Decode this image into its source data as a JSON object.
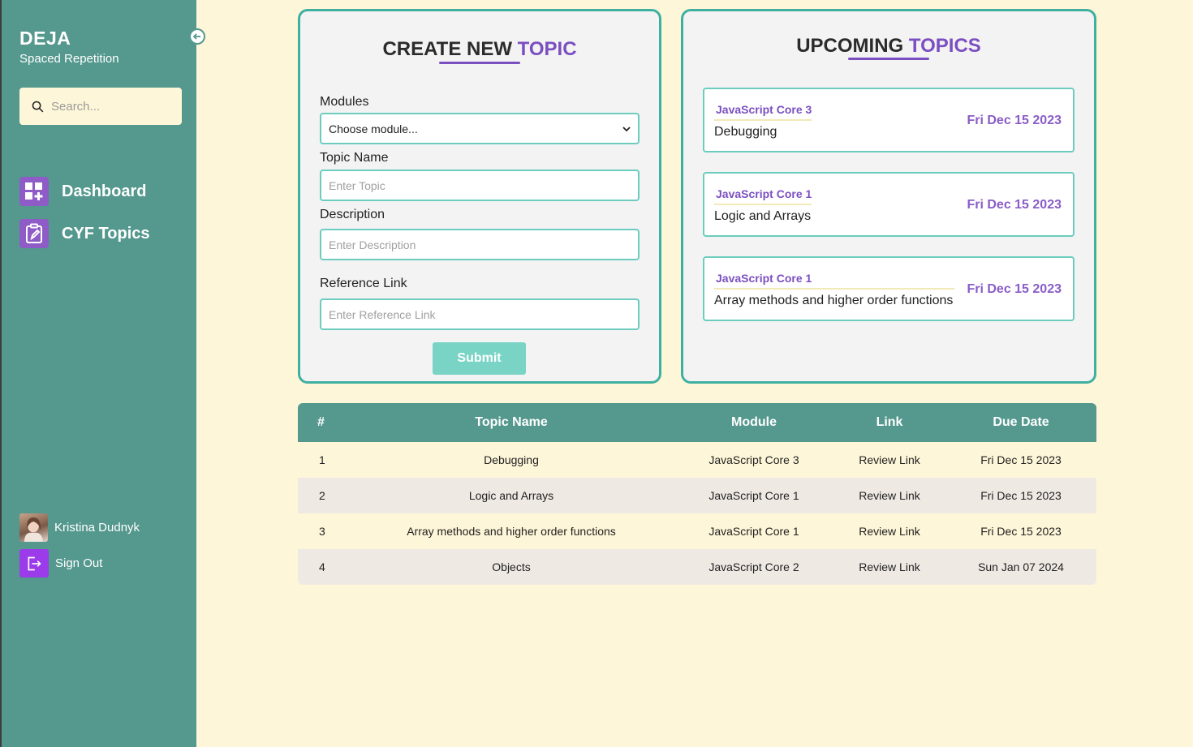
{
  "sidebar": {
    "brand_title": "DEJA",
    "brand_subtitle": "Spaced Repetition",
    "search_placeholder": "Search...",
    "nav": [
      {
        "label": "Dashboard",
        "icon": "dashboard-grid-icon"
      },
      {
        "label": "CYF Topics",
        "icon": "clipboard-edit-icon"
      }
    ],
    "user_name": "Kristina Dudnyk",
    "sign_out_label": "Sign Out"
  },
  "create_form": {
    "title_prefix": "CREATE NEW ",
    "title_accent": "TOPIC",
    "modules_label": "Modules",
    "modules_selected": "Choose module...",
    "topic_label": "Topic Name",
    "topic_placeholder": "Enter Topic",
    "description_label": "Description",
    "description_placeholder": "Enter Description",
    "reference_label": "Reference Link",
    "reference_placeholder": "Enter Reference Link",
    "submit_label": "Submit"
  },
  "upcoming": {
    "title_prefix": "UPCOMING ",
    "title_accent": "TOPICS",
    "items": [
      {
        "module": "JavaScript Core 3",
        "name": "Debugging",
        "date": "Fri Dec 15 2023"
      },
      {
        "module": "JavaScript Core 1",
        "name": "Logic and Arrays",
        "date": "Fri Dec 15 2023"
      },
      {
        "module": "JavaScript Core 1",
        "name": "Array methods and higher order functions",
        "date": "Fri Dec 15 2023"
      }
    ]
  },
  "table": {
    "headers": [
      "#",
      "Topic Name",
      "Module",
      "Link",
      "Due Date"
    ],
    "rows": [
      {
        "num": "1",
        "topic": "Debugging",
        "module": "JavaScript Core 3",
        "link": "Review Link",
        "due": "Fri Dec 15 2023"
      },
      {
        "num": "2",
        "topic": "Logic and Arrays",
        "module": "JavaScript Core 1",
        "link": "Review Link",
        "due": "Fri Dec 15 2023"
      },
      {
        "num": "3",
        "topic": "Array methods and higher order functions",
        "module": "JavaScript Core 1",
        "link": "Review Link",
        "due": "Fri Dec 15 2023"
      },
      {
        "num": "4",
        "topic": "Objects",
        "module": "JavaScript Core 2",
        "link": "Review Link",
        "due": "Sun Jan 07 2024"
      }
    ]
  },
  "colors": {
    "sidebar": "#54988e",
    "page_bg": "#fef6d8",
    "accent_purple": "#7b4fc0",
    "card_border": "#3fb0a0",
    "submit": "#79d4c6"
  }
}
